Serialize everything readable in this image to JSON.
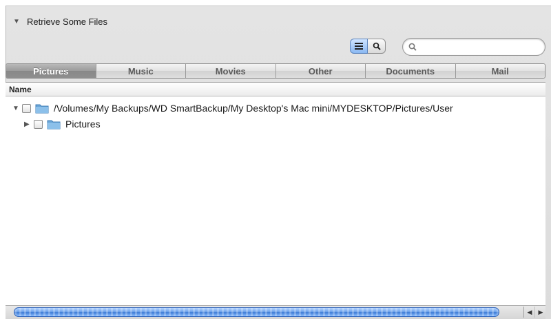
{
  "panel": {
    "title": "Retrieve Some Files"
  },
  "search": {
    "placeholder": "",
    "value": ""
  },
  "tabs": [
    {
      "label": "Pictures",
      "active": true
    },
    {
      "label": "Music",
      "active": false
    },
    {
      "label": "Movies",
      "active": false
    },
    {
      "label": "Other",
      "active": false
    },
    {
      "label": "Documents",
      "active": false
    },
    {
      "label": "Mail",
      "active": false
    }
  ],
  "list": {
    "column_header": "Name",
    "rows": [
      {
        "label": "/Volumes/My Backups/WD SmartBackup/My Desktop's Mac mini/MYDESKTOP/Pictures/User",
        "expanded": true,
        "checked": false
      },
      {
        "label": "Pictures",
        "expanded": false,
        "checked": false
      }
    ]
  },
  "colors": {
    "accent": "#3d7bd6",
    "folder": "#6aa6d8",
    "active_tab": "#9a9a9a"
  },
  "icons": {
    "list_view": "list-view-icon",
    "search_view": "magnifier-icon",
    "search_field": "search-icon",
    "folder": "folder-icon"
  }
}
